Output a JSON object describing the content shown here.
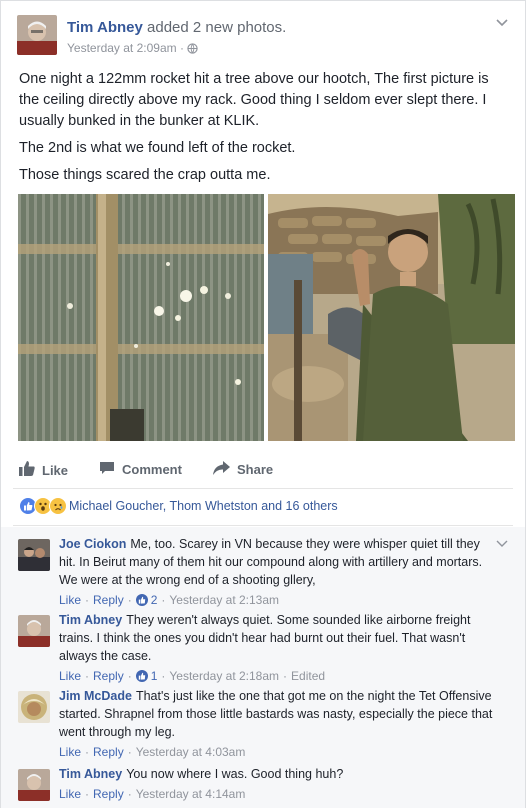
{
  "post": {
    "author": "Tim Abney",
    "verb": "added 2 new photos.",
    "time": "Yesterday at 2:09am",
    "privacy_icon": "globe-icon",
    "paragraphs": [
      "One night a 122mm rocket hit a tree above our hootch, The first picture is the ceiling directly above my rack. Good thing I seldom ever slept there. I usually bunked in the bunker at KLIK.",
      "The 2nd is what we found left of the rocket.",
      "Those things scared the crap outta me."
    ]
  },
  "actions": {
    "like": "Like",
    "comment": "Comment",
    "share": "Share"
  },
  "reactions": {
    "icons": [
      "like-reaction-icon",
      "wow-reaction-icon",
      "sad-reaction-icon"
    ],
    "summary": "Michael Goucher, Thom Whetston and 16 others"
  },
  "comments": [
    {
      "name": "Joe Ciokon",
      "text": "Me, too. Scarey in VN because they were whisper quiet till they hit. In Beirut many of them hit our compound along with artillery and mortars. We were at the wrong end of a shooting gllery,",
      "like": "Like",
      "reply": "Reply",
      "like_count": "2",
      "time": "Yesterday at 2:13am",
      "edited": ""
    },
    {
      "name": "Tim Abney",
      "text": "They weren't always quiet. Some sounded like airborne freight trains. I think the ones you didn't hear had burnt out their fuel. That wasn't always the case.",
      "like": "Like",
      "reply": "Reply",
      "like_count": "1",
      "time": "Yesterday at 2:18am",
      "edited": "Edited"
    },
    {
      "name": "Jim McDade",
      "text": "That's just like the one that got me on the night the Tet Offensive started. Shrapnel from those little bastards was nasty, especially the piece that went through my leg.",
      "like": "Like",
      "reply": "Reply",
      "like_count": "",
      "time": "Yesterday at 4:03am",
      "edited": ""
    },
    {
      "name": "Tim Abney",
      "text": "You now where I was. Good thing huh?",
      "like": "Like",
      "reply": "Reply",
      "like_count": "",
      "time": "Yesterday at 4:14am",
      "edited": ""
    }
  ],
  "colors": {
    "link": "#365899",
    "action_link": "#4267b2",
    "meta": "#90949c"
  }
}
